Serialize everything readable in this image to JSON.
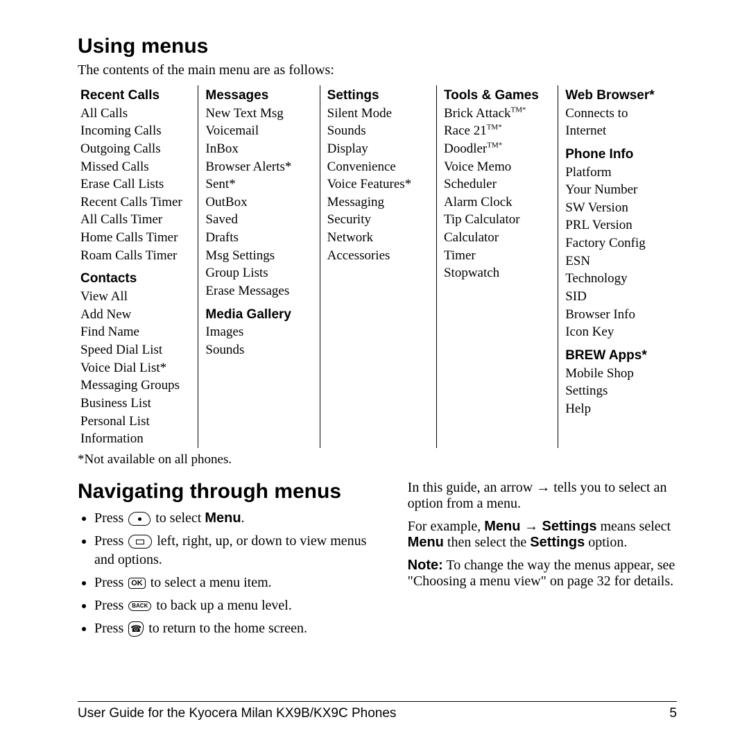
{
  "heading1": "Using menus",
  "intro": "The contents of the main menu are as follows:",
  "columns": [
    {
      "groups": [
        {
          "title": "Recent Calls",
          "items": [
            "All Calls",
            "Incoming Calls",
            "Outgoing Calls",
            "Missed Calls",
            "Erase Call Lists",
            "Recent Calls Timer",
            "All Calls Timer",
            "Home Calls Timer",
            "Roam Calls Timer"
          ]
        },
        {
          "title": "Contacts",
          "items": [
            "View All",
            "Add New",
            "Find Name",
            "Speed Dial List",
            "Voice Dial List*",
            "Messaging Groups",
            "Business List",
            "Personal List",
            "Information"
          ]
        }
      ]
    },
    {
      "groups": [
        {
          "title": "Messages",
          "items": [
            "New Text Msg",
            "Voicemail",
            "InBox",
            "Browser Alerts*",
            "Sent*",
            "OutBox",
            "Saved",
            "Drafts",
            "Msg Settings",
            "Group Lists",
            "Erase Messages"
          ]
        },
        {
          "title": "Media Gallery",
          "items": [
            "Images",
            "Sounds"
          ]
        }
      ]
    },
    {
      "groups": [
        {
          "title": "Settings",
          "items": [
            "Silent Mode",
            "Sounds",
            "Display",
            "Convenience",
            "Voice Features*",
            "Messaging",
            "Security",
            "Network",
            "Accessories"
          ]
        }
      ]
    },
    {
      "groups": [
        {
          "title": "Tools & Games",
          "items_raw": [
            "Brick Attack<span class='tm'>TM*</span>",
            "Race 21<span class='tm'>TM*</span>",
            "Doodler<span class='tm'>TM*</span>",
            "Voice Memo",
            "Scheduler",
            "Alarm Clock",
            "Tip Calculator",
            "Calculator",
            "Timer",
            "Stopwatch"
          ]
        }
      ]
    },
    {
      "groups": [
        {
          "title": "Web Browser*",
          "items": [
            "Connects to Internet"
          ]
        },
        {
          "title": "Phone Info",
          "items": [
            "Platform",
            "Your Number",
            "SW Version",
            "PRL Version",
            "Factory Config",
            "ESN",
            "Technology",
            "SID",
            "Browser Info",
            "Icon Key"
          ]
        },
        {
          "title": "BREW Apps*",
          "items": [
            "Mobile Shop",
            "Settings",
            "Help"
          ]
        }
      ]
    }
  ],
  "footnote": "*Not available on all phones.",
  "heading2": "Navigating through menus",
  "nav_bullets": {
    "b1_pre": "Press ",
    "b1_post": "  to select ",
    "b1_bold": "Menu",
    "b1_end": ".",
    "b2_pre": "Press ",
    "b2_post": "  left, right, up, or down to view menus and options.",
    "b3_pre": "Press ",
    "b3_post": "  to select a menu item.",
    "b4_pre": "Press ",
    "b4_post": "  to back up a menu level.",
    "b5_pre": "Press ",
    "b5_post": "  to return to the home screen."
  },
  "right_p1_a": "In this guide, an arrow ",
  "right_p1_b": " tells you to select an option from a menu.",
  "right_p2_a": "For example, ",
  "right_p2_menu": "Menu",
  "right_p2_arrow": " → ",
  "right_p2_settings": "Settings",
  "right_p2_b": " means select ",
  "right_p2_menu2": "Menu",
  "right_p2_c": " then select the ",
  "right_p2_settings2": "Settings",
  "right_p2_d": " option.",
  "note_label": "Note:",
  "note_text": "  To change the way the menus appear, see \"Choosing a menu view\" on page 32 for details.",
  "footer_left": "User Guide for the Kyocera Milan KX9B/KX9C Phones",
  "footer_right": "5",
  "keys": {
    "ok": "OK",
    "back": "BACK"
  }
}
